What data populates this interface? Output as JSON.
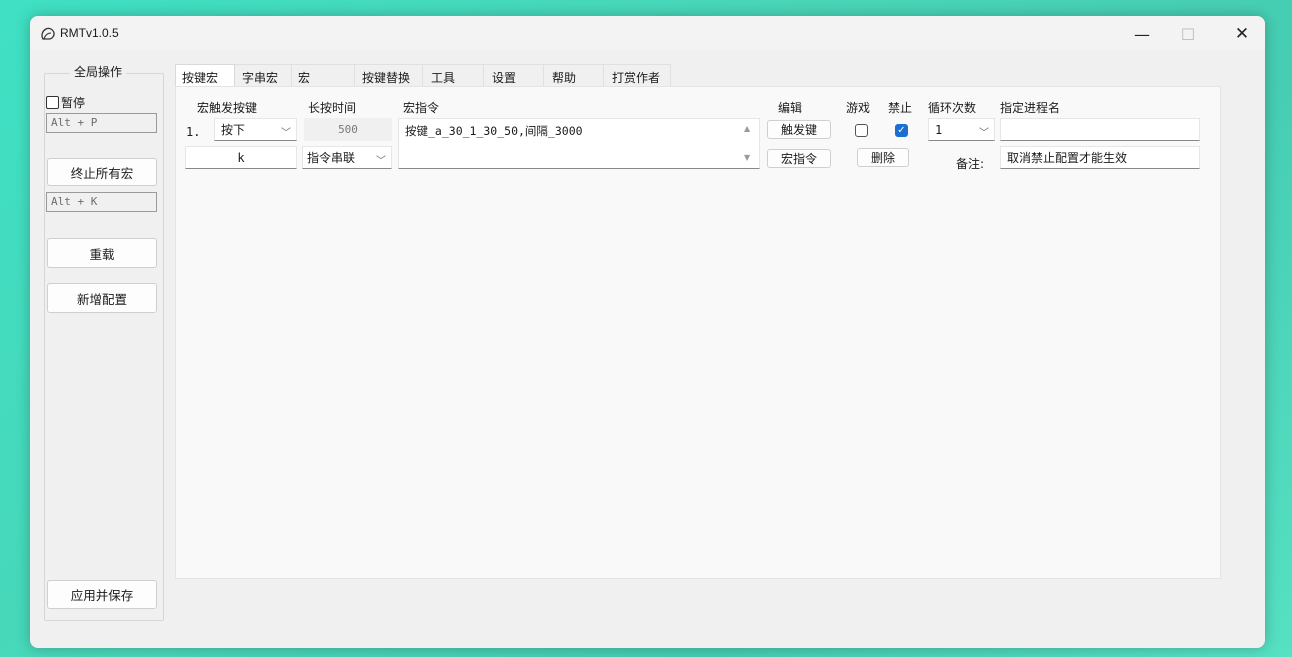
{
  "window": {
    "title": "RMTv1.0.5",
    "minimize_glyph": "—",
    "maximize_glyph": "☐",
    "close_glyph": "✕"
  },
  "left_panel": {
    "group_title": "全局操作",
    "pause_label": "暂停",
    "pause_hotkey": "Alt + P",
    "stop_all_label": "终止所有宏",
    "stop_all_hotkey": "Alt + K",
    "reload_label": "重载",
    "new_config_label": "新增配置",
    "apply_save_label": "应用并保存"
  },
  "tabs": [
    "按键宏",
    "字串宏",
    "宏",
    "按键替换",
    "工具",
    "设置",
    "帮助",
    "打赏作者"
  ],
  "headers": {
    "trigger_key": "宏触发按键",
    "long_press": "长按时间",
    "macro_cmd": "宏指令",
    "edit": "编辑",
    "game": "游戏",
    "disable": "禁止",
    "loop_count": "循环次数",
    "process_name": "指定进程名"
  },
  "row": {
    "index": "1.",
    "trigger_mode": "按下",
    "key": "k",
    "long_press_value": "500",
    "mode": "指令串联",
    "command": "按键_a_30_1_30_50,间隔_3000",
    "btn_trigger_key": "触发键",
    "btn_macro_cmd": "宏指令",
    "btn_delete": "删除",
    "game_checked": false,
    "disable_checked": true,
    "loop_count": "1",
    "process_name": "",
    "note_label": "备注:",
    "note_value": "取消禁止配置才能生效"
  }
}
